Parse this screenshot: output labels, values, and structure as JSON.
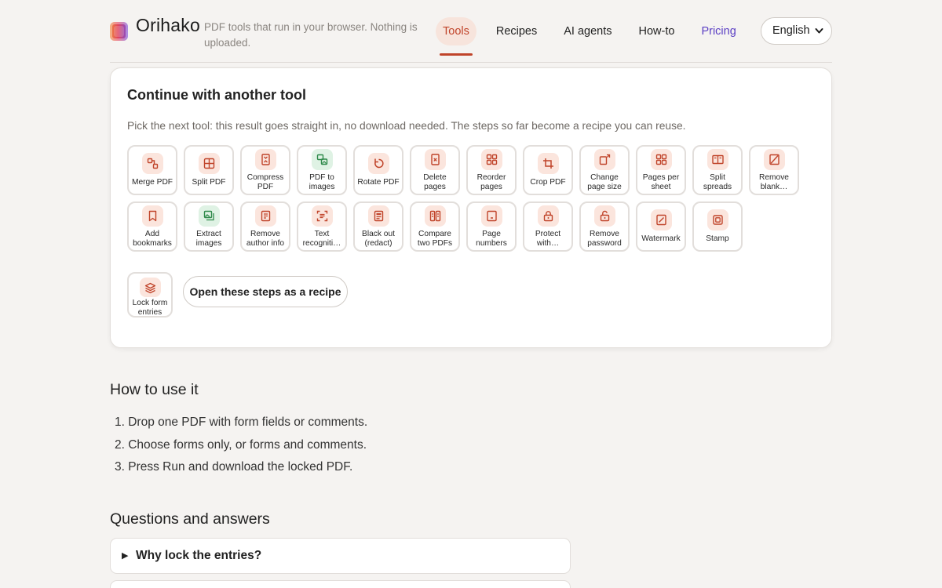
{
  "app": {
    "brand": "Orihako",
    "tagline": "PDF tools that run in your browser. Nothing is uploaded.",
    "accent": "#c0442a",
    "logo_icon": "orihako-logo-icon"
  },
  "nav": {
    "items": [
      "Tools",
      "Recipes",
      "AI agents",
      "How-to",
      "Pricing"
    ],
    "active": "Tools",
    "language": "English"
  },
  "card": {
    "title": "Continue with another tool",
    "subtitle": "Pick the next tool: this result goes straight in, no download needed. The steps so far become a recipe you can reuse.",
    "tools": [
      {
        "label": "Merge PDF",
        "icon": "merge-icon"
      },
      {
        "label": "Split PDF",
        "icon": "split-icon"
      },
      {
        "label": "Compress PDF",
        "icon": "compress-icon"
      },
      {
        "label": "PDF to images",
        "icon": "image-icon"
      },
      {
        "label": "Rotate PDF",
        "icon": "rotate-icon"
      },
      {
        "label": "Delete pages",
        "icon": "delete-page-icon"
      },
      {
        "label": "Reorder pages",
        "icon": "grid-icon"
      },
      {
        "label": "Crop PDF",
        "icon": "crop-icon"
      },
      {
        "label": "Change page size",
        "icon": "resize-icon"
      },
      {
        "label": "Pages per sheet",
        "icon": "grid-icon"
      },
      {
        "label": "Split spreads",
        "icon": "book-icon"
      },
      {
        "label": "Remove blank…",
        "icon": "blank-page-icon"
      },
      {
        "label": "Add bookmarks",
        "icon": "bookmark-icon"
      },
      {
        "label": "Extract images",
        "icon": "image-icon"
      },
      {
        "label": "Remove author info",
        "icon": "document-icon"
      },
      {
        "label": "Text recogniti…",
        "icon": "scan-icon"
      },
      {
        "label": "Black out (redact)",
        "icon": "document-icon"
      },
      {
        "label": "Compare two PDFs",
        "icon": "compare-icon"
      },
      {
        "label": "Page numbers",
        "icon": "page-number-icon"
      },
      {
        "label": "Protect with…",
        "icon": "lock-icon"
      },
      {
        "label": "Remove password",
        "icon": "unlock-icon"
      },
      {
        "label": "Watermark",
        "icon": "watermark-icon"
      },
      {
        "label": "Stamp",
        "icon": "stamp-icon"
      },
      {
        "label": "Lock form entries",
        "icon": "layers-icon"
      }
    ],
    "recipe_button": "Open these steps as a recipe"
  },
  "howto": {
    "title": "How to use it",
    "steps": [
      "1. Drop one PDF with form fields or comments.",
      "2. Choose forms only, or forms and comments.",
      "3. Press Run and download the locked PDF."
    ]
  },
  "faq": {
    "title": "Questions and answers",
    "items": [
      "Why lock the entries?",
      ""
    ]
  }
}
